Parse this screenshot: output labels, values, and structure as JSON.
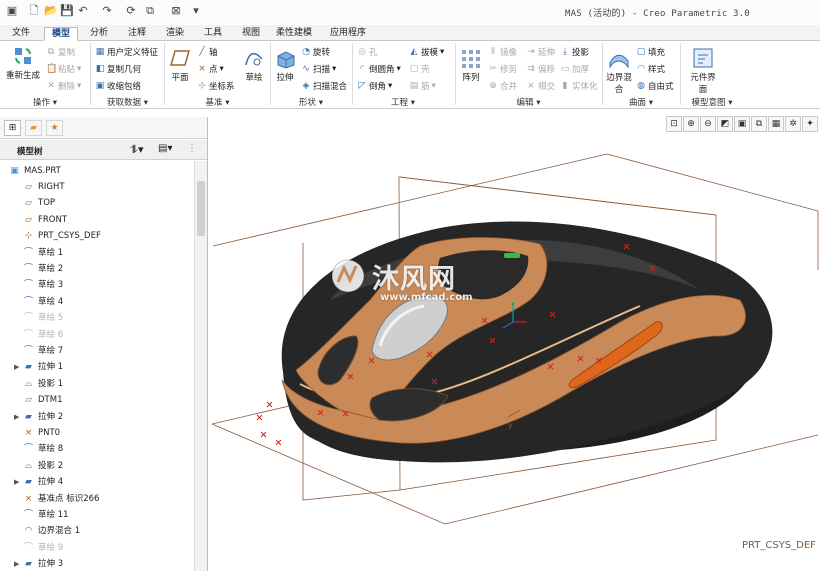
{
  "window": {
    "title": "MAS (活动的) - Creo Parametric 3.0"
  },
  "quick_access": {
    "icons": [
      "new-icon",
      "open-icon",
      "save-icon",
      "undo-icon",
      "redo-icon",
      "regenerate-icon",
      "windows-icon",
      "close-window-icon",
      "customize-icon"
    ]
  },
  "tabs": [
    "文件",
    "模型",
    "分析",
    "注释",
    "渲染",
    "工具",
    "视图",
    "柔性建模",
    "应用程序"
  ],
  "active_tab": "模型",
  "ribbon": {
    "operations": {
      "regenerate": "重新生成",
      "copy": "复制",
      "paste": "粘贴",
      "delete": "删除",
      "label": "操作"
    },
    "get_data": {
      "udf": "用户定义特征",
      "copy_geom": "复制几何",
      "shrinkwrap": "收缩包络",
      "label": "获取数据"
    },
    "datum": {
      "plane": "平面",
      "axis": "轴",
      "point": "点",
      "csys": "坐标系",
      "sketch": "草绘",
      "label": "基准"
    },
    "shapes": {
      "extrude": "拉伸",
      "revolve": "旋转",
      "sweep": "扫描",
      "swept_blend": "扫描混合",
      "label": "形状"
    },
    "engineering": {
      "hole": "孔",
      "round": "倒圆角",
      "chamfer": "倒角",
      "draft": "拔模",
      "shell": "壳",
      "rib": "筋",
      "label": "工程"
    },
    "editing": {
      "pattern": "阵列",
      "mirror": "镜像",
      "trim": "修剪",
      "merge": "合并",
      "extend": "延伸",
      "offset": "偏移",
      "intersect": "相交",
      "project": "投影",
      "thicken": "加厚",
      "solidify": "实体化",
      "label": "编辑"
    },
    "surfaces": {
      "boundary_blend": "边界混合",
      "fill": "填充",
      "style": "样式",
      "freestyle": "自由式",
      "label": "曲面"
    },
    "model_intent": {
      "component_interface": "元件界面",
      "label": "模型意图"
    }
  },
  "tree": {
    "header": "模型树",
    "root": "MAS.PRT",
    "items": [
      {
        "label": "RIGHT",
        "icon": "datum-plane-icon",
        "suppressed": false,
        "expandable": false
      },
      {
        "label": "TOP",
        "icon": "datum-plane-icon",
        "suppressed": false,
        "expandable": false
      },
      {
        "label": "FRONT",
        "icon": "datum-plane-icon",
        "suppressed": false,
        "expandable": false
      },
      {
        "label": "PRT_CSYS_DEF",
        "icon": "csys-icon",
        "suppressed": false,
        "expandable": false
      },
      {
        "label": "草绘 1",
        "icon": "sketch-icon",
        "suppressed": false,
        "expandable": false
      },
      {
        "label": "草绘 2",
        "icon": "sketch-icon",
        "suppressed": false,
        "expandable": false
      },
      {
        "label": "草绘 3",
        "icon": "sketch-icon",
        "suppressed": false,
        "expandable": false
      },
      {
        "label": "草绘 4",
        "icon": "sketch-icon",
        "suppressed": false,
        "expandable": false
      },
      {
        "label": "草绘 5",
        "icon": "sketch-icon",
        "suppressed": true,
        "expandable": false
      },
      {
        "label": "草绘 6",
        "icon": "sketch-icon",
        "suppressed": true,
        "expandable": false
      },
      {
        "label": "草绘 7",
        "icon": "sketch-icon",
        "suppressed": false,
        "expandable": false
      },
      {
        "label": "拉伸 1",
        "icon": "extrude-icon",
        "suppressed": false,
        "expandable": true
      },
      {
        "label": "投影 1",
        "icon": "projection-icon",
        "suppressed": false,
        "expandable": false
      },
      {
        "label": "DTM1",
        "icon": "datum-plane-icon",
        "suppressed": false,
        "expandable": false
      },
      {
        "label": "拉伸 2",
        "icon": "extrude-icon",
        "suppressed": false,
        "expandable": true
      },
      {
        "label": "PNT0",
        "icon": "datum-point-icon",
        "suppressed": false,
        "expandable": false
      },
      {
        "label": "草绘 8",
        "icon": "sketch-icon",
        "suppressed": false,
        "expandable": false
      },
      {
        "label": "投影 2",
        "icon": "projection-icon",
        "suppressed": false,
        "expandable": false
      },
      {
        "label": "拉伸 4",
        "icon": "extrude-icon",
        "suppressed": false,
        "expandable": true
      },
      {
        "label": "基准点 标识266",
        "icon": "datum-point-icon",
        "suppressed": false,
        "expandable": false
      },
      {
        "label": "草绘 11",
        "icon": "sketch-icon",
        "suppressed": false,
        "expandable": false
      },
      {
        "label": "边界混合 1",
        "icon": "boundary-blend-icon",
        "suppressed": false,
        "expandable": false
      },
      {
        "label": "草绘 9",
        "icon": "sketch-icon",
        "suppressed": true,
        "expandable": false
      },
      {
        "label": "拉伸 3",
        "icon": "extrude-icon",
        "suppressed": false,
        "expandable": true
      }
    ]
  },
  "viewport": {
    "csys_label": "PRT_CSYS_DEF",
    "watermark_main": "沐风网",
    "watermark_sub": "www.mfcad.com",
    "colors": {
      "body": "#262626",
      "trim": "#c98a58",
      "button": "#e0661b",
      "led": "#2fbf3a",
      "datum_lines": "#8a5a3a"
    }
  }
}
